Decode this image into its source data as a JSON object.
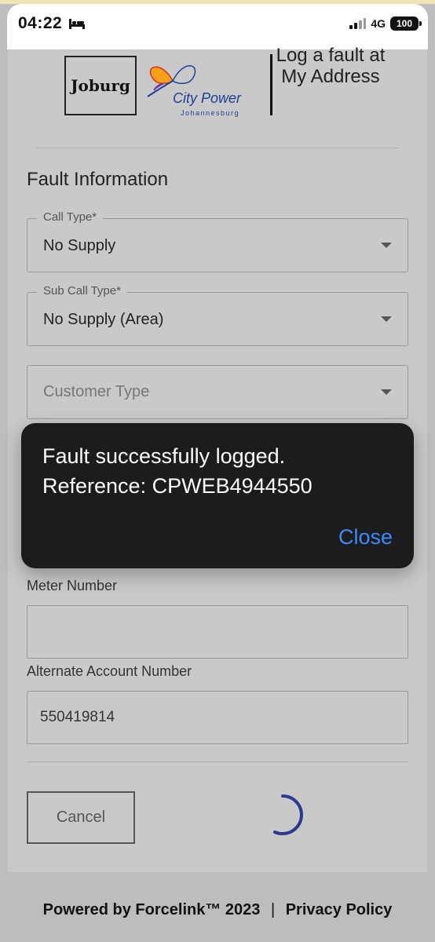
{
  "status_bar": {
    "time": "04:22",
    "network": "4G",
    "battery": "100"
  },
  "header": {
    "joburg_logo_text": "Joburg",
    "citypower_title": "City Power",
    "citypower_subtitle": "Johannesburg",
    "page_heading": "Log a fault at My Address"
  },
  "form": {
    "section_title": "Fault Information",
    "call_type": {
      "label": "Call Type*",
      "value": "No Supply"
    },
    "sub_call_type": {
      "label": "Sub Call Type*",
      "value": "No Supply (Area)"
    },
    "customer_type": {
      "placeholder": "Customer Type"
    },
    "meter_number": {
      "label": "Meter Number",
      "value": ""
    },
    "alternate_account": {
      "label": "Alternate Account Number",
      "value": "550419814"
    },
    "cancel_label": "Cancel"
  },
  "alert": {
    "line1": "Fault successfully logged.",
    "line2": "Reference: CPWEB4944550",
    "close_label": "Close"
  },
  "footer": {
    "powered_by": "Powered by Forcelink™ 2023",
    "separator": "|",
    "privacy_policy": "Privacy Policy"
  },
  "colors": {
    "alert_background": "#1c1c1e",
    "alert_action": "#3b8cf7",
    "spinner": "#2b3a8f",
    "citypower_blue": "#1c3f9a"
  }
}
